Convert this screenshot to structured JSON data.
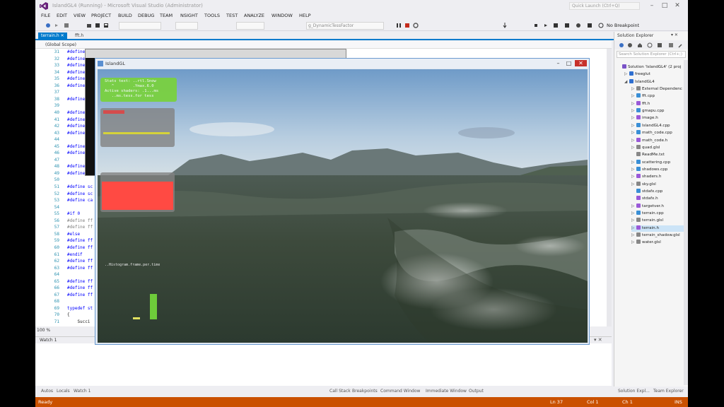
{
  "window": {
    "title": "IslandGL4 (Running) - Microsoft Visual Studio (Administrator)",
    "quick_launch_placeholder": "Quick Launch (Ctrl+Q)",
    "minimize": "–",
    "maximize": "□",
    "close": "✕"
  },
  "menu": [
    "FILE",
    "EDIT",
    "VIEW",
    "PROJECT",
    "BUILD",
    "DEBUG",
    "TEAM",
    "NSIGHT",
    "TOOLS",
    "TEST",
    "ANALYZE",
    "WINDOW",
    "HELP"
  ],
  "toolbar": {
    "frame_combo": "g_DynamicTessFactor",
    "breakpoint_label": "No Breakpoint"
  },
  "doc_tabs": [
    {
      "label": "terrain.h",
      "active": true
    },
    {
      "label": "fft.h",
      "active": false
    }
  ],
  "scope": "(Global Scope)",
  "code_lines": [
    {
      "n": "31",
      "t": "#define",
      "c": "kw"
    },
    {
      "n": "32",
      "t": "#define",
      "c": "kw"
    },
    {
      "n": "33",
      "t": "#define",
      "c": "kw"
    },
    {
      "n": "34",
      "t": "#define",
      "c": "kw"
    },
    {
      "n": "35",
      "t": "#define",
      "c": "kw"
    },
    {
      "n": "36",
      "t": "#define",
      "c": "kw"
    },
    {
      "n": "37",
      "t": "",
      "c": "kw"
    },
    {
      "n": "38",
      "t": "#define",
      "c": "kw"
    },
    {
      "n": "39",
      "t": "",
      "c": "kw"
    },
    {
      "n": "40",
      "t": "#define",
      "c": "kw"
    },
    {
      "n": "41",
      "t": "#define",
      "c": "kw"
    },
    {
      "n": "42",
      "t": "#define",
      "c": "kw"
    },
    {
      "n": "43",
      "t": "#define",
      "c": "kw"
    },
    {
      "n": "44",
      "t": "",
      "c": "kw"
    },
    {
      "n": "45",
      "t": "#define",
      "c": "kw"
    },
    {
      "n": "46",
      "t": "#define",
      "c": "kw"
    },
    {
      "n": "47",
      "t": "",
      "c": "kw"
    },
    {
      "n": "48",
      "t": "#define",
      "c": "kw"
    },
    {
      "n": "49",
      "t": "#define",
      "c": "kw"
    },
    {
      "n": "50",
      "t": "",
      "c": "kw"
    },
    {
      "n": "51",
      "t": "#define sc",
      "c": "kw"
    },
    {
      "n": "52",
      "t": "#define sc",
      "c": "kw"
    },
    {
      "n": "53",
      "t": "#define ca",
      "c": "kw"
    },
    {
      "n": "54",
      "t": "",
      "c": "kw"
    },
    {
      "n": "55",
      "t": "#if 0",
      "c": "kw"
    },
    {
      "n": "56",
      "t": "#define ff",
      "c": "gray"
    },
    {
      "n": "57",
      "t": "#define ff",
      "c": "gray"
    },
    {
      "n": "58",
      "t": "#else",
      "c": "kw"
    },
    {
      "n": "59",
      "t": "#define ff",
      "c": "kw"
    },
    {
      "n": "60",
      "t": "#define ff",
      "c": "kw"
    },
    {
      "n": "61",
      "t": "#endif",
      "c": "kw"
    },
    {
      "n": "62",
      "t": "#define ff",
      "c": "kw"
    },
    {
      "n": "63",
      "t": "#define ff",
      "c": "kw"
    },
    {
      "n": "64",
      "t": "",
      "c": "kw"
    },
    {
      "n": "65",
      "t": "#define ff",
      "c": "kw"
    },
    {
      "n": "66",
      "t": "#define ff",
      "c": "kw"
    },
    {
      "n": "67",
      "t": "#define ff",
      "c": "kw"
    },
    {
      "n": "68",
      "t": "",
      "c": "kw"
    },
    {
      "n": "69",
      "t": "typedef st",
      "c": "kw"
    },
    {
      "n": "70",
      "t": "{",
      "c": "dark"
    },
    {
      "n": "71",
      "t": "    Succi",
      "c": "dark"
    }
  ],
  "editor_zoom": "100 %",
  "watch": {
    "title": "Watch 1"
  },
  "bottom_tabs_left": [
    "Autos",
    "Locals",
    "Watch 1"
  ],
  "bottom_tabs_right": [
    "Call Stack",
    "Breakpoints",
    "Command Window",
    "Immediate Window",
    "Output"
  ],
  "solution_explorer": {
    "title": "Solution Explorer",
    "search_placeholder": "Search Solution Explorer (Ctrl+;)",
    "items": [
      {
        "label": "Solution 'IslandGL4' (2 proj",
        "arrow": "",
        "color": "#7a52c7",
        "indent": 0
      },
      {
        "label": "freeglut",
        "arrow": "▷",
        "color": "#2f6fd0",
        "indent": 1
      },
      {
        "label": "IslandGL4",
        "arrow": "◢",
        "color": "#2f6fd0",
        "indent": 1
      },
      {
        "label": "External Dependenc",
        "arrow": "▷",
        "color": "#888888",
        "indent": 2
      },
      {
        "label": "fft.cpp",
        "arrow": "▷",
        "color": "#3a8fd6",
        "indent": 2
      },
      {
        "label": "fft.h",
        "arrow": "▷",
        "color": "#9a5ad8",
        "indent": 2
      },
      {
        "label": "gmapu.cpp",
        "arrow": "▷",
        "color": "#3a8fd6",
        "indent": 2
      },
      {
        "label": "image.h",
        "arrow": "▷",
        "color": "#9a5ad8",
        "indent": 2
      },
      {
        "label": "IslandGL4.cpp",
        "arrow": "▷",
        "color": "#3a8fd6",
        "indent": 2
      },
      {
        "label": "math_code.cpp",
        "arrow": "▷",
        "color": "#3a8fd6",
        "indent": 2
      },
      {
        "label": "math_code.h",
        "arrow": "▷",
        "color": "#9a5ad8",
        "indent": 2
      },
      {
        "label": "quad.glsl",
        "arrow": "▷",
        "color": "#888888",
        "indent": 2
      },
      {
        "label": "ReadMe.txt",
        "arrow": "",
        "color": "#888888",
        "indent": 2
      },
      {
        "label": "scattering.cpp",
        "arrow": "▷",
        "color": "#3a8fd6",
        "indent": 2
      },
      {
        "label": "shadows.cpp",
        "arrow": "▷",
        "color": "#3a8fd6",
        "indent": 2
      },
      {
        "label": "shaders.h",
        "arrow": "▷",
        "color": "#9a5ad8",
        "indent": 2
      },
      {
        "label": "sky.glsl",
        "arrow": "▷",
        "color": "#888888",
        "indent": 2
      },
      {
        "label": "stdafx.cpp",
        "arrow": "",
        "color": "#3a8fd6",
        "indent": 2
      },
      {
        "label": "stdafx.h",
        "arrow": "",
        "color": "#9a5ad8",
        "indent": 2
      },
      {
        "label": "targetver.h",
        "arrow": "▷",
        "color": "#9a5ad8",
        "indent": 2
      },
      {
        "label": "terrain.cpp",
        "arrow": "▷",
        "color": "#3a8fd6",
        "indent": 2
      },
      {
        "label": "terrain.glsl",
        "arrow": "▷",
        "color": "#888888",
        "indent": 2
      },
      {
        "label": "terrain.h",
        "arrow": "▷",
        "color": "#9a5ad8",
        "indent": 2,
        "selected": true
      },
      {
        "label": "terrain_shadow.glsl",
        "arrow": "▷",
        "color": "#888888",
        "indent": 2
      },
      {
        "label": "water.glsl",
        "arrow": "▷",
        "color": "#888888",
        "indent": 2
      }
    ],
    "bottom_tabs": [
      "Solution Expl...",
      "Team Explorer"
    ]
  },
  "statusbar": {
    "left": "Ready",
    "ln": "Ln 37",
    "col": "Col 1",
    "ch": "Ch 1",
    "ins": "INS"
  },
  "gl_window": {
    "title": "IslandGL",
    "hud_lines": [
      "Stats text: ..rtl.Snow",
      "   ^        .Ymax.6.0",
      "Active shaders: .1...ms",
      "   ..ms.tess.for tess"
    ],
    "perf_title": "..Histogram.frame.per.time"
  },
  "colors": {
    "accent": "#007acc",
    "statusbar": "#ca5100",
    "hud_green": "#79d23c",
    "hud_red": "#ff4a43"
  }
}
